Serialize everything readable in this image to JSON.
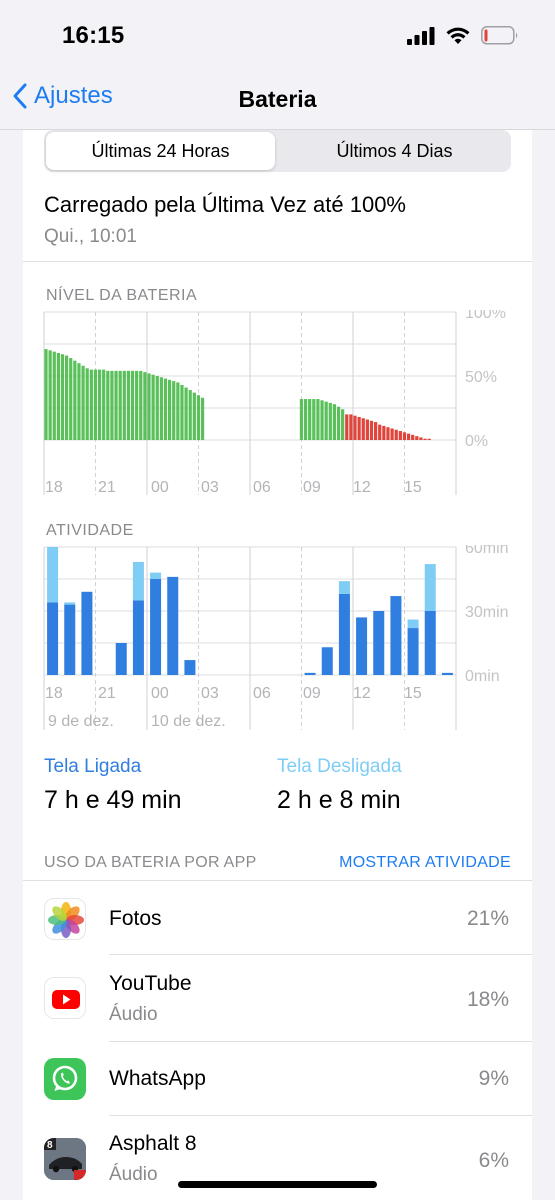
{
  "status_bar": {
    "time": "16:15"
  },
  "nav": {
    "back_label": "Ajustes",
    "title": "Bateria"
  },
  "segments": [
    "Últimas 24 Horas",
    "Últimos 4 Dias"
  ],
  "last_charged": {
    "title": "Carregado pela Última Vez até 100%",
    "subtitle": "Qui., 10:01"
  },
  "battery_level_label": "NÍVEL DA BATERIA",
  "activity_label": "ATIVIDADE",
  "screen": {
    "on_label": "Tela Ligada",
    "on_value": "7 h e 49 min",
    "off_label": "Tela Desligada",
    "off_value": "2 h e 8 min"
  },
  "usage": {
    "label": "USO DA BATERIA POR APP",
    "show_activity": "MOSTRAR ATIVIDADE",
    "apps": [
      {
        "name": "Fotos",
        "sub": "",
        "percent": "21%",
        "icon": "photos-icon"
      },
      {
        "name": "YouTube",
        "sub": "Áudio",
        "percent": "18%",
        "icon": "youtube-icon"
      },
      {
        "name": "WhatsApp",
        "sub": "",
        "percent": "9%",
        "icon": "whatsapp-icon"
      },
      {
        "name": "Asphalt 8",
        "sub": "Áudio",
        "percent": "6%",
        "icon": "asphalt-icon"
      }
    ]
  },
  "colors": {
    "accent": "#1e7cf2",
    "battery_normal": "#5ac05a",
    "battery_low": "#e0443a",
    "activity_screen_on": "#2f7ee0",
    "activity_screen_off": "#7fcdf5"
  },
  "chart_data": [
    {
      "type": "bar",
      "title": "NÍVEL DA BATERIA",
      "x_tick_labels": [
        "18",
        "21",
        "00",
        "03",
        "06",
        "09",
        "12",
        "15"
      ],
      "y_tick_labels": [
        "100%",
        "50%",
        "0%"
      ],
      "ylim": [
        0,
        100
      ],
      "unit": "%",
      "series": [
        {
          "values": [
            71,
            70,
            69,
            68,
            67,
            66,
            64,
            62,
            60,
            58,
            56,
            55,
            55,
            55,
            55,
            54,
            54,
            54,
            54,
            54,
            54,
            54,
            54,
            54,
            53,
            52,
            51,
            50,
            49,
            48,
            47,
            46,
            45,
            43,
            41,
            39,
            37,
            35,
            33
          ],
          "start_slot": 0
        },
        {
          "values": [
            32,
            32,
            32,
            32,
            32,
            31,
            30,
            29,
            28,
            26,
            24
          ],
          "start_slot": 62
        },
        {
          "values": [
            20,
            20,
            19,
            18,
            17,
            16,
            15,
            14,
            12,
            11,
            10,
            9,
            8,
            7,
            6,
            5,
            4,
            3,
            2,
            1,
            1
          ],
          "start_slot": 73,
          "low_power": true
        }
      ],
      "slots": 100
    },
    {
      "type": "bar",
      "title": "ATIVIDADE",
      "x_tick_labels": [
        "18",
        "21",
        "00",
        "03",
        "06",
        "09",
        "12",
        "15"
      ],
      "date_labels": [
        "9 de dez.",
        "10 de dez."
      ],
      "y_tick_labels": [
        "60min",
        "30min",
        "0min"
      ],
      "ylim": [
        0,
        60
      ],
      "unit": "min",
      "categories": [
        "17",
        "18",
        "19",
        "20",
        "21",
        "22",
        "23",
        "00",
        "01",
        "02",
        "03",
        "04",
        "05",
        "06",
        "07",
        "08",
        "09",
        "10",
        "11",
        "12",
        "13",
        "14",
        "15",
        "16"
      ],
      "series": [
        {
          "name": "Tela Ligada",
          "values": [
            34,
            33,
            39,
            0,
            15,
            35,
            45,
            46,
            7,
            0,
            0,
            0,
            0,
            0,
            0,
            1,
            13,
            38,
            27,
            30,
            37,
            22,
            30,
            1
          ]
        },
        {
          "name": "Tela Desligada",
          "values": [
            26,
            1,
            0,
            0,
            0,
            18,
            3,
            0,
            0,
            0,
            0,
            0,
            0,
            0,
            0,
            0,
            0,
            6,
            0,
            0,
            0,
            4,
            22,
            0
          ]
        }
      ]
    }
  ]
}
